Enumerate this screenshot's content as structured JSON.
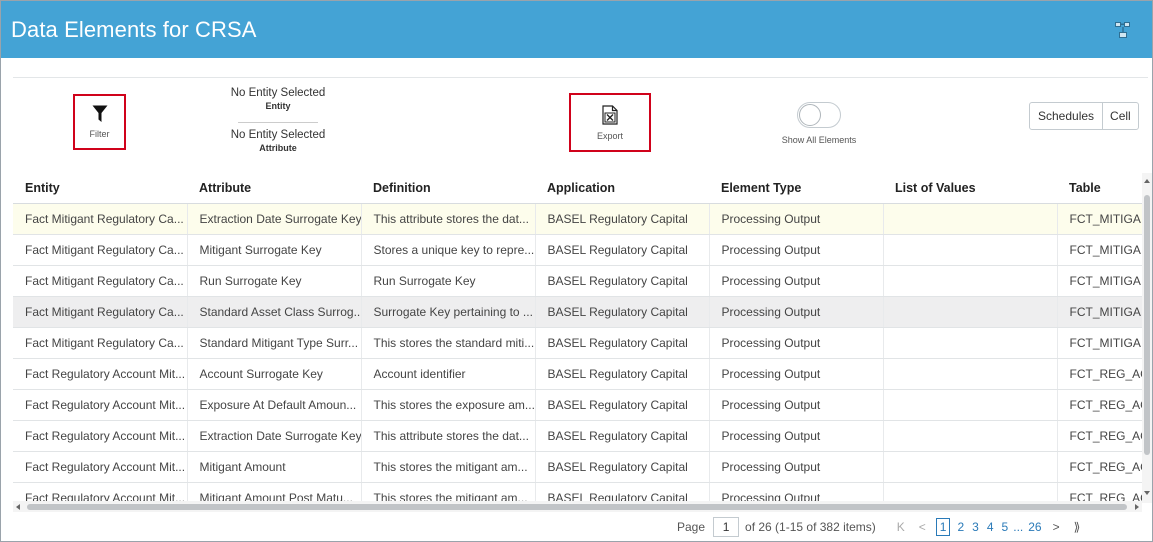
{
  "header": {
    "title": "Data Elements for CRSA",
    "icon": "hierarchy-icon",
    "background": "#44a3d5"
  },
  "toolbar": {
    "filter_label": "Filter",
    "entity_value": "No Entity Selected",
    "entity_label": "Entity",
    "attribute_value": "No Entity Selected",
    "attribute_label": "Attribute",
    "export_label": "Export",
    "show_all_label": "Show All Elements",
    "show_all_on": false,
    "schedules_label": "Schedules",
    "cell_label": "Cell",
    "highlight_color": "#d0021b"
  },
  "grid": {
    "columns": [
      "Entity",
      "Attribute",
      "Definition",
      "Application",
      "Element Type",
      "List of Values",
      "Table"
    ],
    "rows": [
      [
        "Fact Mitigant Regulatory Ca...",
        "Extraction Date Surrogate Key",
        "This attribute stores the dat...",
        "BASEL Regulatory Capital",
        "Processing Output",
        "",
        "FCT_MITIGA"
      ],
      [
        "Fact Mitigant Regulatory Ca...",
        "Mitigant Surrogate Key",
        "Stores a unique key to repre...",
        "BASEL Regulatory Capital",
        "Processing Output",
        "",
        "FCT_MITIGA"
      ],
      [
        "Fact Mitigant Regulatory Ca...",
        "Run Surrogate Key",
        "Run Surrogate Key",
        "BASEL Regulatory Capital",
        "Processing Output",
        "",
        "FCT_MITIGA"
      ],
      [
        "Fact Mitigant Regulatory Ca...",
        "Standard Asset Class Surrog...",
        "Surrogate Key pertaining to ...",
        "BASEL Regulatory Capital",
        "Processing Output",
        "",
        "FCT_MITIGA"
      ],
      [
        "Fact Mitigant Regulatory Ca...",
        "Standard Mitigant Type Surr...",
        "This stores the standard miti...",
        "BASEL Regulatory Capital",
        "Processing Output",
        "",
        "FCT_MITIGA"
      ],
      [
        "Fact Regulatory Account Mit...",
        "Account Surrogate Key",
        "Account identifier",
        "BASEL Regulatory Capital",
        "Processing Output",
        "",
        "FCT_REG_AC"
      ],
      [
        "Fact Regulatory Account Mit...",
        "Exposure At Default Amoun...",
        "This stores the exposure am...",
        "BASEL Regulatory Capital",
        "Processing Output",
        "",
        "FCT_REG_AC"
      ],
      [
        "Fact Regulatory Account Mit...",
        "Extraction Date Surrogate Key",
        "This attribute stores the dat...",
        "BASEL Regulatory Capital",
        "Processing Output",
        "",
        "FCT_REG_AC"
      ],
      [
        "Fact Regulatory Account Mit...",
        "Mitigant Amount",
        "This stores the mitigant am...",
        "BASEL Regulatory Capital",
        "Processing Output",
        "",
        "FCT_REG_AC"
      ],
      [
        "Fact Regulatory Account Mit...",
        "Mitigant Amount Post Matu...",
        "This stores the mitigant am...",
        "BASEL Regulatory Capital",
        "Processing Output",
        "",
        "FCT_REG_AC"
      ]
    ]
  },
  "pager": {
    "page_label": "Page",
    "current_page": "1",
    "of_text": "of 26  (1-15 of 382 items)",
    "first_label": "K",
    "prev_label": "<",
    "pages": [
      "1",
      "2",
      "3",
      "4",
      "5"
    ],
    "ellipsis": "...",
    "last_page": "26",
    "next_label": ">",
    "last_label": "⟫"
  }
}
